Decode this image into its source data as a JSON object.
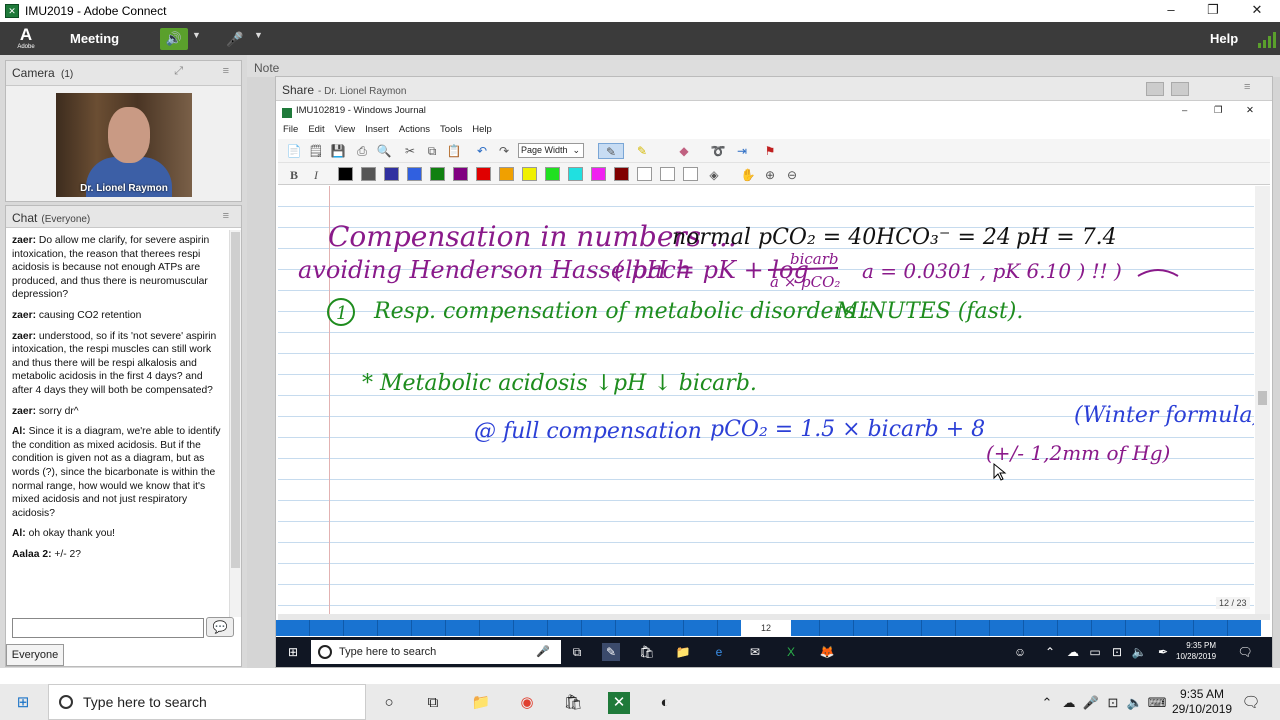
{
  "window": {
    "title": "IMU2019 - Adobe Connect",
    "minimize": "–",
    "maximize": "❐",
    "close": "✕"
  },
  "menubar": {
    "logo": "A",
    "logo_sub": "Adobe",
    "meeting_label": "Meeting",
    "help_label": "Help",
    "speaker_icon": "speaker-icon",
    "mic_icon": "microphone-icon"
  },
  "camera": {
    "title": "Camera",
    "count": "(1)",
    "presenter_name": "Dr. Lionel Raymon"
  },
  "chat": {
    "title": "Chat",
    "scope": "(Everyone)",
    "messages": [
      {
        "sender": "zaer:",
        "text": " Do allow me clarify, for severe aspirin intoxication, the reason that therees respi acidosis is because not enough ATPs are produced, and thus there is neuromuscular depression?"
      },
      {
        "sender": "zaer:",
        "text": " causing CO2 retention"
      },
      {
        "sender": "zaer:",
        "text": " understood, so if its 'not severe' aspirin intoxication, the respi muscles can still work and thus there will be respi alkalosis and metabolic acidosis in the first 4 days? and after 4 days they will both be compensated?"
      },
      {
        "sender": "zaer:",
        "text": " sorry dr^"
      },
      {
        "sender": "Al:",
        "text": " Since it is a diagram, we're able to identify the condition as mixed acidosis. But if the condition is given not as a diagram, but as words (?), since the bicarbonate is within the normal range, how would we know that it's mixed acidosis and not just respiratory acidosis?"
      },
      {
        "sender": "Al:",
        "text": " oh okay thank you!"
      },
      {
        "sender": "Aalaa 2:",
        "text": " +/- 2?"
      }
    ],
    "input_value": "",
    "recipient_button": "Everyone"
  },
  "note": {
    "title": "Note"
  },
  "share": {
    "title": "Share",
    "presenter": "- Dr. Lionel Raymon"
  },
  "journal": {
    "title": "IMU102819 - Windows Journal",
    "menu": [
      "File",
      "Edit",
      "View",
      "Insert",
      "Actions",
      "Tools",
      "Help"
    ],
    "zoom": "Page Width",
    "page_indicator": "12 / 23",
    "current_page": "12",
    "colors": [
      "#000000",
      "#555555",
      "#3030a0",
      "#3060e0",
      "#108010",
      "#800080",
      "#e00000",
      "#f0a000",
      "#f0f000",
      "#20e020",
      "#20e0e0",
      "#f020f0",
      "#800000",
      "#ffffff",
      "#ffffff",
      "#ffffff"
    ]
  },
  "handwriting": {
    "line1_title": "Compensation in numbers ...",
    "line1_normal": "normal",
    "line1_pco2": "pCO₂ = 40",
    "line1_hco3": "HCO₃⁻ = 24",
    "line1_ph": "pH = 7.4",
    "line2_avoid": "avoiding Henderson Hasselbach",
    "line2_eq": "( pH = pK + log",
    "line2_num": "bicarb",
    "line2_den": "a × pCO₂",
    "line2_rest": "a = 0.0301 , pK 6.10 ) !! )",
    "line3_num": "1",
    "line3_text": "Resp. compensation of metabolic disorders :",
    "line3_minutes": "MINUTES (fast).",
    "line4_text": "* Metabolic acidosis  ↓pH ↓ bicarb.",
    "line5_text": "@ full compensation",
    "line5_formula": "pCO₂ = 1.5 × bicarb + 8",
    "line5_winter": "(Winter formula)",
    "line6_range": "(+/- 1,2mm of Hg)"
  },
  "inner_taskbar": {
    "search_placeholder": "Type here to search",
    "time": "9:35 PM",
    "date": "10/28/2019"
  },
  "taskbar": {
    "search_placeholder": "Type here to search",
    "time": "9:35 AM",
    "date": "29/10/2019"
  }
}
